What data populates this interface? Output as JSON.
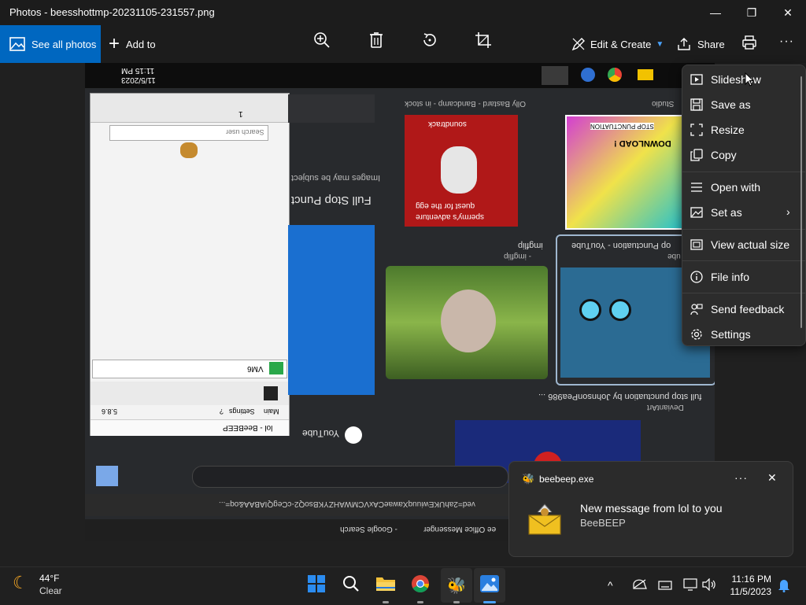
{
  "window": {
    "title": "Photos - beesshottmp-20231105-231557.png",
    "minimize_glyph": "—",
    "maximize_glyph": "❐",
    "close_glyph": "✕"
  },
  "toolbar": {
    "see_all_label": "See all photos",
    "add_to_label": "Add to",
    "edit_create_label": "Edit & Create",
    "share_label": "Share",
    "more_glyph": "···"
  },
  "context_menu": {
    "items": [
      {
        "label": "Slideshow",
        "icon": "slideshow-icon"
      },
      {
        "label": "Save as",
        "icon": "save-icon"
      },
      {
        "label": "Resize",
        "icon": "resize-icon"
      },
      {
        "label": "Copy",
        "icon": "copy-icon"
      },
      {
        "label": "Open with",
        "icon": "open-with-icon"
      },
      {
        "label": "Set as",
        "icon": "set-as-icon"
      },
      {
        "label": "View actual size",
        "icon": "actual-size-icon"
      },
      {
        "label": "File info",
        "icon": "info-icon"
      },
      {
        "label": "Send feedback",
        "icon": "feedback-icon"
      },
      {
        "label": "Settings",
        "icon": "gear-icon"
      }
    ]
  },
  "screenshot_content": {
    "clock_time": "11:15 PM",
    "clock_date": "11/5/2023",
    "youtube_label": "YouTube",
    "full_stop_text": "Full Stop Punct",
    "images_subject_text": "Images may be subject",
    "search_user_placeholder": "Search user",
    "beebeep_title": "lol - BeeBEEP",
    "beebeep_version": "5.8.6",
    "beebeep_menu_main": "Main",
    "beebeep_menu_settings": "Settings",
    "beebeep_menu_help": "?",
    "beebeep_input_value": "VM6",
    "tab_count": "1",
    "card1_caption": "Olly Bastard - Bandcamp - in stock",
    "card1_sub": "quest for the egg",
    "card1_title": "spermy's adventure",
    "card1_tag": "soundtrack",
    "card2_caption": "Studio",
    "card2_download": "DOWNLOAD !",
    "card3_caption": "imgflip",
    "card3_sub": "- imgflip",
    "card4_caption": "op Punctuation - YouTube",
    "card4_sub": "ube",
    "card5_caption": "full stop punctuation by JohnsonPea986 ...",
    "card5_sub": "DeviantArt",
    "address_text": "ved=2ahUKEwiuuqXawaeCAxVCMWAHZYKBsoQ2-cCegQIABAA&oq=...",
    "google_search_tab": "- Google Search",
    "office_tab": "ee Office Messenger",
    "stop_punctuation": "STOP PUNCTUATION"
  },
  "toast": {
    "app_name": "beebeep.exe",
    "message": "New message from lol to you",
    "sender": "BeeBEEP"
  },
  "taskbar": {
    "weather_temp": "44°F",
    "weather_desc": "Clear",
    "time": "11:16 PM",
    "date": "11/5/2023"
  },
  "colors": {
    "accent": "#0067c0",
    "menu_bg": "#2c2c2c",
    "taskbar_bg": "#202020"
  }
}
